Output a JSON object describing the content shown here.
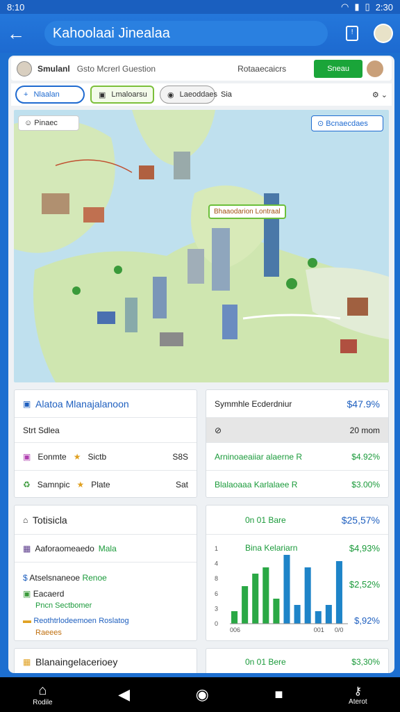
{
  "status": {
    "left": "8:10",
    "time": "2:30"
  },
  "appbar": {
    "title": "Kahoolaai Jinealaa",
    "doc_icon": "doc-icon"
  },
  "header": {
    "user": "Smulanl",
    "subtitle": "Gsto Mcrerl Guestion",
    "control": "Rotaaecaicrs",
    "button": "Sneau"
  },
  "toolbar": {
    "pill1": "Nlaalan",
    "pill2": "Lmaloarsu",
    "pill3": "Laeoddaes",
    "sort": "Sia"
  },
  "map": {
    "tag_left": "Pinaec",
    "tag_right": "Bcnaecdaes",
    "callout": "Bhaaodarion Lontraal"
  },
  "cards": {
    "allocation": {
      "title": "Alatoa Mlanajalanoon",
      "sub": "Strt Sdlea",
      "rows": [
        {
          "a": "Eonmte",
          "b": "Sictb",
          "c": "S8S"
        },
        {
          "a": "Samnpic",
          "b": "Plate",
          "c": "Sat"
        }
      ]
    },
    "summary": {
      "title": "Symmhle Ecderdniur",
      "value": "$47.9%",
      "sub": "20 mom",
      "rows": [
        {
          "label": "Arninoaeaiiar alaerne R",
          "value": "$4.92%"
        },
        {
          "label": "Blalaoaaa Karlalaee R",
          "value": "$3.00%"
        }
      ]
    },
    "totals": {
      "title": "Totisicla",
      "r1": "Aaforaomeaedo",
      "r1b": "Mala",
      "r2": "Atselsnaneoe",
      "r2b": "Renoe",
      "r3": "Eacaerd",
      "r3b": "Pncn Sectbomer",
      "r4": "Reothtrlodeemoen",
      "r4b": "Roslatog",
      "r4c": "Raeees"
    },
    "chart": {
      "title": "0n 01 Bare",
      "value": "$25,57%",
      "sub": "Bina Kelariarn",
      "v1": "$4,93%",
      "v2": "$2,52%",
      "v3": "$,92%"
    },
    "bottom_left": {
      "title": "Blanaingelacerioey"
    },
    "bottom_right": {
      "title": "0n 01 Bere",
      "value": "$3,30%"
    }
  },
  "chart_data": {
    "type": "bar",
    "categories": [
      "006",
      "",
      "",
      "",
      "",
      "",
      "",
      "",
      "001",
      "",
      "0/0"
    ],
    "series": [
      {
        "values": [
          2,
          6,
          8,
          9,
          4,
          11,
          3,
          9,
          2,
          3,
          10
        ]
      }
    ],
    "ylim": [
      0,
      12
    ],
    "y_ticks": [
      "0",
      "3",
      "6",
      "8",
      "4",
      "1"
    ],
    "colors": [
      "#2aa845",
      "#1e84c8"
    ]
  },
  "navbar": {
    "home": "Rodile",
    "right": "Aterot"
  }
}
